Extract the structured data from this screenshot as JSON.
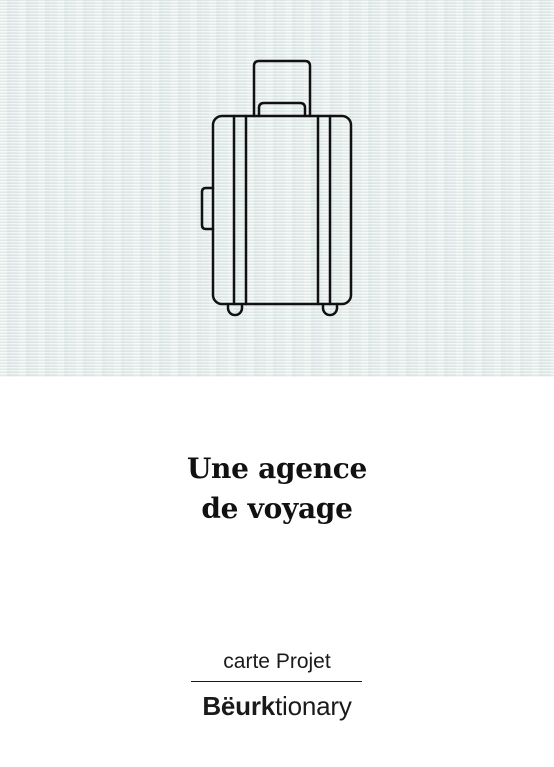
{
  "card": {
    "title_line1": "Une agence",
    "title_line2": "de voyage",
    "card_type": "carte Projet",
    "brand": {
      "bold_part": "Bëurk",
      "regular_part": "tionary"
    },
    "illustration": "suitcase-icon",
    "colors": {
      "panel_background": "#e3ecea",
      "ink": "#111111"
    }
  }
}
